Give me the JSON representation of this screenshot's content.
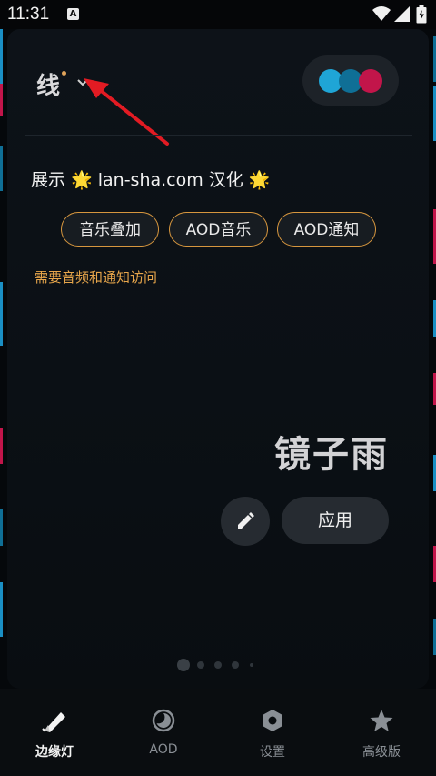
{
  "status_bar": {
    "time": "11:31",
    "notification_icon": "a-badge-icon",
    "icons": [
      "wifi-icon",
      "signal-icon",
      "battery-charging-icon"
    ]
  },
  "header": {
    "style_title": "线",
    "dropdown_icon": "chevron-down-icon",
    "annotation_icon": "red-arrow-icon",
    "color_selector": {
      "colors": [
        "#1fa5d6",
        "#0f6f96",
        "#c2154a"
      ]
    }
  },
  "demo": {
    "text": "展示 🌟 lan-sha.com 汉化 🌟",
    "chips": [
      {
        "label": "音乐叠加"
      },
      {
        "label": "AOD音乐"
      },
      {
        "label": "AOD通知"
      }
    ],
    "permission_note": "需要音频和通知访问"
  },
  "preset": {
    "name": "镜子雨",
    "edit_icon": "pencil-icon",
    "apply_label": "应用",
    "page_count": 5,
    "current_page": 1
  },
  "bottom_nav": {
    "items": [
      {
        "label": "边缘灯",
        "icon": "edge-light-icon",
        "active": true
      },
      {
        "label": "AOD",
        "icon": "aod-icon",
        "active": false
      },
      {
        "label": "设置",
        "icon": "settings-hex-icon",
        "active": false
      },
      {
        "label": "高级版",
        "icon": "star-icon",
        "active": false
      }
    ]
  },
  "colors": {
    "accent_orange": "#d6963e",
    "permission_text": "#e8a64b",
    "edge_blue": "#1a8fc4",
    "edge_pink": "#c2154a"
  }
}
